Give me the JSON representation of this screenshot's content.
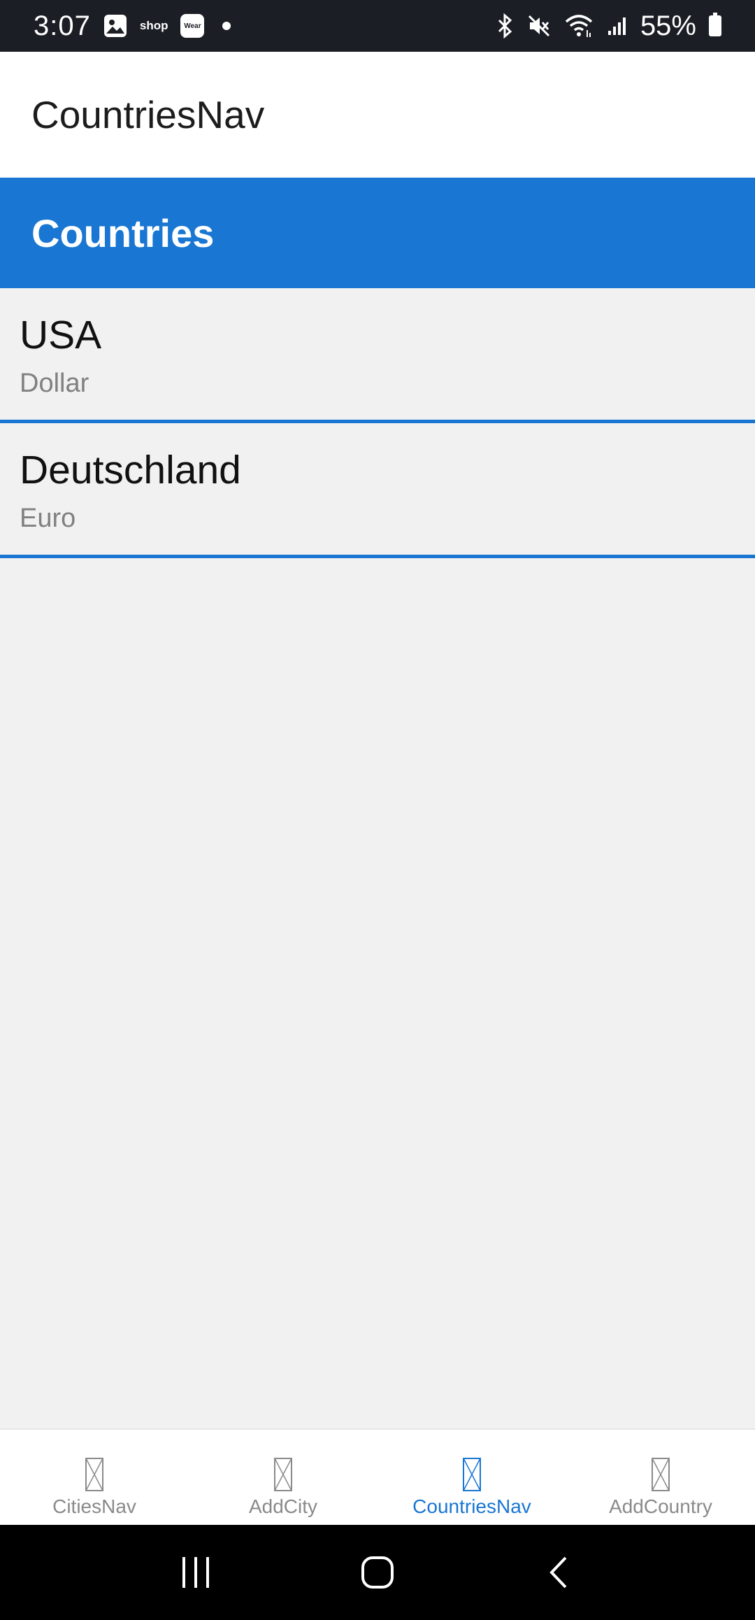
{
  "status_bar": {
    "time": "3:07",
    "notification_icons": [
      "gallery-icon",
      "shop-icon",
      "wear-icon",
      "dot-icon"
    ],
    "shop_text": "shop",
    "wear_text": "Wear",
    "right_icons": [
      "bluetooth-icon",
      "mute-icon",
      "wifi-icon",
      "signal-icon"
    ],
    "battery_percent": "55%"
  },
  "app_bar": {
    "title": "CountriesNav"
  },
  "header": {
    "title": "Countries"
  },
  "countries": [
    {
      "name": "USA",
      "currency": "Dollar"
    },
    {
      "name": "Deutschland",
      "currency": "Euro"
    }
  ],
  "bottom_nav": {
    "tabs": [
      {
        "label": "CitiesNav",
        "active": false
      },
      {
        "label": "AddCity",
        "active": false
      },
      {
        "label": "CountriesNav",
        "active": true
      },
      {
        "label": "AddCountry",
        "active": false
      }
    ],
    "active_color": "#1976d2",
    "inactive_color": "#8a8a8a"
  },
  "colors": {
    "accent": "#1976d2",
    "status_bar_bg": "#1b1e25",
    "list_bg": "#f1f1f1"
  }
}
